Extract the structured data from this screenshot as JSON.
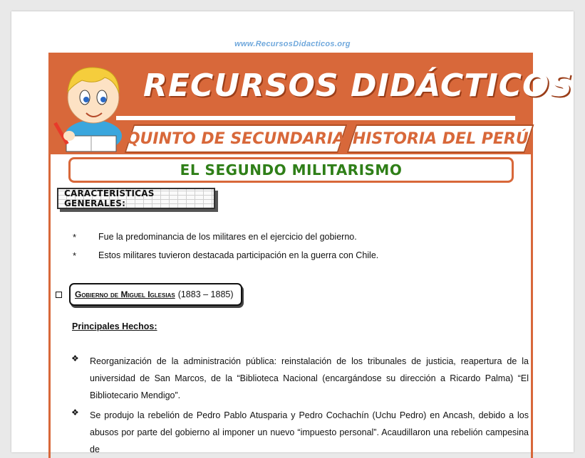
{
  "site_url": "www.RecursosDidacticos.org",
  "banner": {
    "title": "RECURSOS DIDÁCTICOS",
    "grade": "QUINTO DE SECUNDARIA",
    "subject": "HISTORIA DEL PERÚ"
  },
  "main_title": "EL SEGUNDO MILITARISMO",
  "section_tag": "CARACTERÍSTICAS GENERALES:",
  "characteristics": [
    "Fue la predominancia de los militares en el ejercicio del gobierno.",
    "Estos militares tuvieron destacada participación en la guerra con Chile."
  ],
  "government": {
    "name": "Gobierno de Miguel Iglesias",
    "years": "(1883 – 1885)"
  },
  "subhead": "Principales Hechos:",
  "facts": [
    "Reorganización de la administración pública: reinstalación de los tribunales de justicia, reapertura de la universidad de San Marcos, de la “Biblioteca Nacional (encargándose su dirección a Ricardo Palma)   “El Bibliotecario Mendigo”.",
    "Se produjo la rebelión de Pedro Pablo Atusparia y Pedro Cochachín (Uchu Pedro) en Ancash, debido a los abusos por parte del gobierno al imponer un nuevo “impuesto personal”. Acaudillaron una rebelión campesina de"
  ],
  "colors": {
    "accent": "#d8683a",
    "title_green": "#2f7f18",
    "url_blue": "#6fa8dc"
  },
  "icons": {
    "star_bullet": "*",
    "diamond_bullet": "❖",
    "square_bullet": "square-outline"
  }
}
